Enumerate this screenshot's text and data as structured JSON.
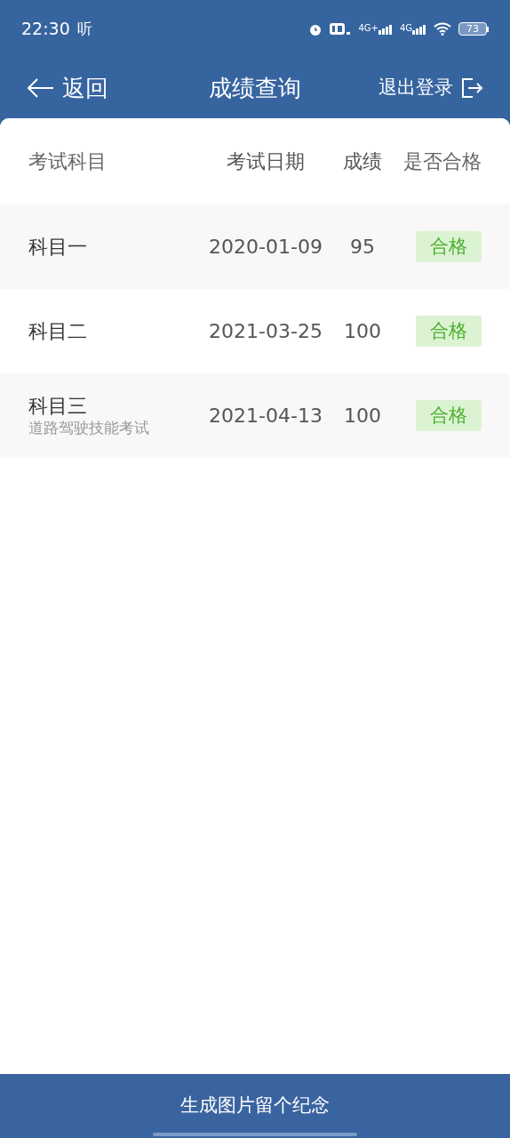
{
  "status_bar": {
    "time": "22:30",
    "app_glyph": "听",
    "network_1": "4G+",
    "network_2": "4G",
    "battery": "73"
  },
  "navbar": {
    "back_label": "返回",
    "title": "成绩查询",
    "logout_label": "退出登录"
  },
  "table": {
    "columns": [
      "考试科目",
      "考试日期",
      "成绩",
      "是否合格"
    ],
    "rows": [
      {
        "subject": "科目一",
        "date": "2020-01-09",
        "score": "95",
        "result": "合格",
        "passed": true
      },
      {
        "subject": "科目二",
        "date": "2021-03-25",
        "score": "100",
        "result": "合格",
        "passed": true
      },
      {
        "subject": "科目三",
        "subtitle": "道路驾驶技能考试",
        "date": "2021-04-13",
        "score": "100",
        "result": "合格",
        "passed": true
      }
    ]
  },
  "bottom_button": "生成图片留个纪念"
}
